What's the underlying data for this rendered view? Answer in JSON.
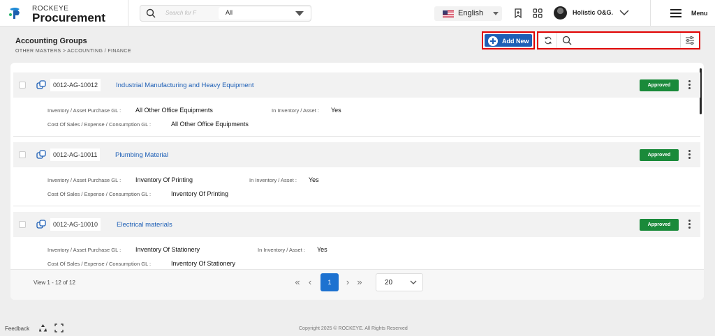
{
  "header": {
    "brand_small": "ROCKEYE",
    "brand_big": "Procurement",
    "search_placeholder": "Search for F",
    "search_scope": "All",
    "language": "English",
    "user_name": "Holistic O&G.",
    "menu_label": "Menu"
  },
  "page": {
    "title": "Accounting Groups",
    "breadcrumb": "OTHER MASTERS >  ACCOUNTING / FINANCE",
    "add_new_label": "Add New"
  },
  "list": {
    "label_purchase_gl": "Inventory / Asset Purchase GL :",
    "label_in_inventory": "In Inventory / Asset :",
    "label_cost_gl": "Cost Of Sales / Expense / Consumption GL :",
    "items": [
      {
        "code": "0012-AG-10012",
        "name": "Industrial Manufacturing and Heavy Equipment",
        "status": "Approved",
        "purchase_gl": "All Other Office Equipments",
        "in_inventory": "Yes",
        "cost_gl": "All Other Office Equipments"
      },
      {
        "code": "0012-AG-10011",
        "name": "Plumbing Material",
        "status": "Approved",
        "purchase_gl": "Inventory Of Printing",
        "in_inventory": "Yes",
        "cost_gl": "Inventory Of Printing"
      },
      {
        "code": "0012-AG-10010",
        "name": "Electrical materials",
        "status": "Approved",
        "purchase_gl": "Inventory Of Stationery",
        "in_inventory": "Yes",
        "cost_gl": "Inventory Of Stationery"
      }
    ]
  },
  "pagination": {
    "view_text": "View 1 - 12 of 12",
    "current_page": "1",
    "page_size": "20"
  },
  "footer": {
    "feedback": "Feedback",
    "copyright": "Copyright 2025 © ROCKEYE. All Rights Reserved"
  },
  "colors": {
    "primary": "#1d5fb6",
    "approved": "#1a8a3a",
    "highlight": "#e00000"
  }
}
